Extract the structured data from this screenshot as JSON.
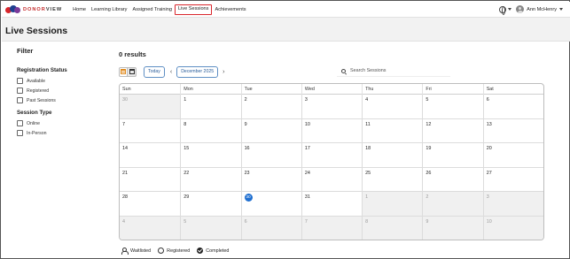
{
  "app": {
    "logo_prefix": "DONOR",
    "logo_suffix": "VIEW"
  },
  "nav": {
    "items": [
      {
        "label": "Home"
      },
      {
        "label": "Learning Library"
      },
      {
        "label": "Assigned Training"
      },
      {
        "label": "Live Sessions",
        "active": true
      },
      {
        "label": "Achievements"
      }
    ],
    "user_name": "Ann McHenry"
  },
  "page": {
    "title": "Live Sessions"
  },
  "filter": {
    "title": "Filter",
    "registration_status": {
      "heading": "Registration Status",
      "options": [
        "Available",
        "Registered",
        "Past Sessions"
      ]
    },
    "session_type": {
      "heading": "Session Type",
      "options": [
        "Online",
        "In-Person"
      ]
    }
  },
  "results": {
    "count_label": "0 results"
  },
  "toolbar": {
    "today_label": "Today",
    "month_label": "December 2025",
    "prev_arrow": "‹",
    "next_arrow": "›",
    "search_placeholder": "Search Sessions"
  },
  "calendar": {
    "weekdays": [
      "Sun",
      "Mon",
      "Tue",
      "Wed",
      "Thu",
      "Fri",
      "Sat"
    ],
    "weeks": [
      [
        {
          "d": "30",
          "out": true
        },
        {
          "d": "1"
        },
        {
          "d": "2"
        },
        {
          "d": "3"
        },
        {
          "d": "4"
        },
        {
          "d": "5"
        },
        {
          "d": "6"
        }
      ],
      [
        {
          "d": "7"
        },
        {
          "d": "8"
        },
        {
          "d": "9"
        },
        {
          "d": "10"
        },
        {
          "d": "11"
        },
        {
          "d": "12"
        },
        {
          "d": "13"
        }
      ],
      [
        {
          "d": "14"
        },
        {
          "d": "15"
        },
        {
          "d": "16"
        },
        {
          "d": "17"
        },
        {
          "d": "18"
        },
        {
          "d": "19"
        },
        {
          "d": "20"
        }
      ],
      [
        {
          "d": "21"
        },
        {
          "d": "22"
        },
        {
          "d": "23"
        },
        {
          "d": "24"
        },
        {
          "d": "25"
        },
        {
          "d": "26"
        },
        {
          "d": "27"
        }
      ],
      [
        {
          "d": "28"
        },
        {
          "d": "29"
        },
        {
          "d": "30",
          "today": true
        },
        {
          "d": "31"
        },
        {
          "d": "1",
          "out": true
        },
        {
          "d": "2",
          "out": true
        },
        {
          "d": "3",
          "out": true
        }
      ],
      [
        {
          "d": "4",
          "out": true
        },
        {
          "d": "5",
          "out": true
        },
        {
          "d": "6",
          "out": true
        },
        {
          "d": "7",
          "out": true
        },
        {
          "d": "8",
          "out": true
        },
        {
          "d": "9",
          "out": true
        },
        {
          "d": "10",
          "out": true
        }
      ]
    ],
    "today_color": "#1f6fd0",
    "active_nav_border": "#d9262c"
  },
  "legend": {
    "items": [
      {
        "label": "Waitlisted",
        "icon": "waitlisted-icon"
      },
      {
        "label": "Registered",
        "icon": "registered-circle-icon"
      },
      {
        "label": "Completed",
        "icon": "completed-check-icon"
      }
    ]
  }
}
